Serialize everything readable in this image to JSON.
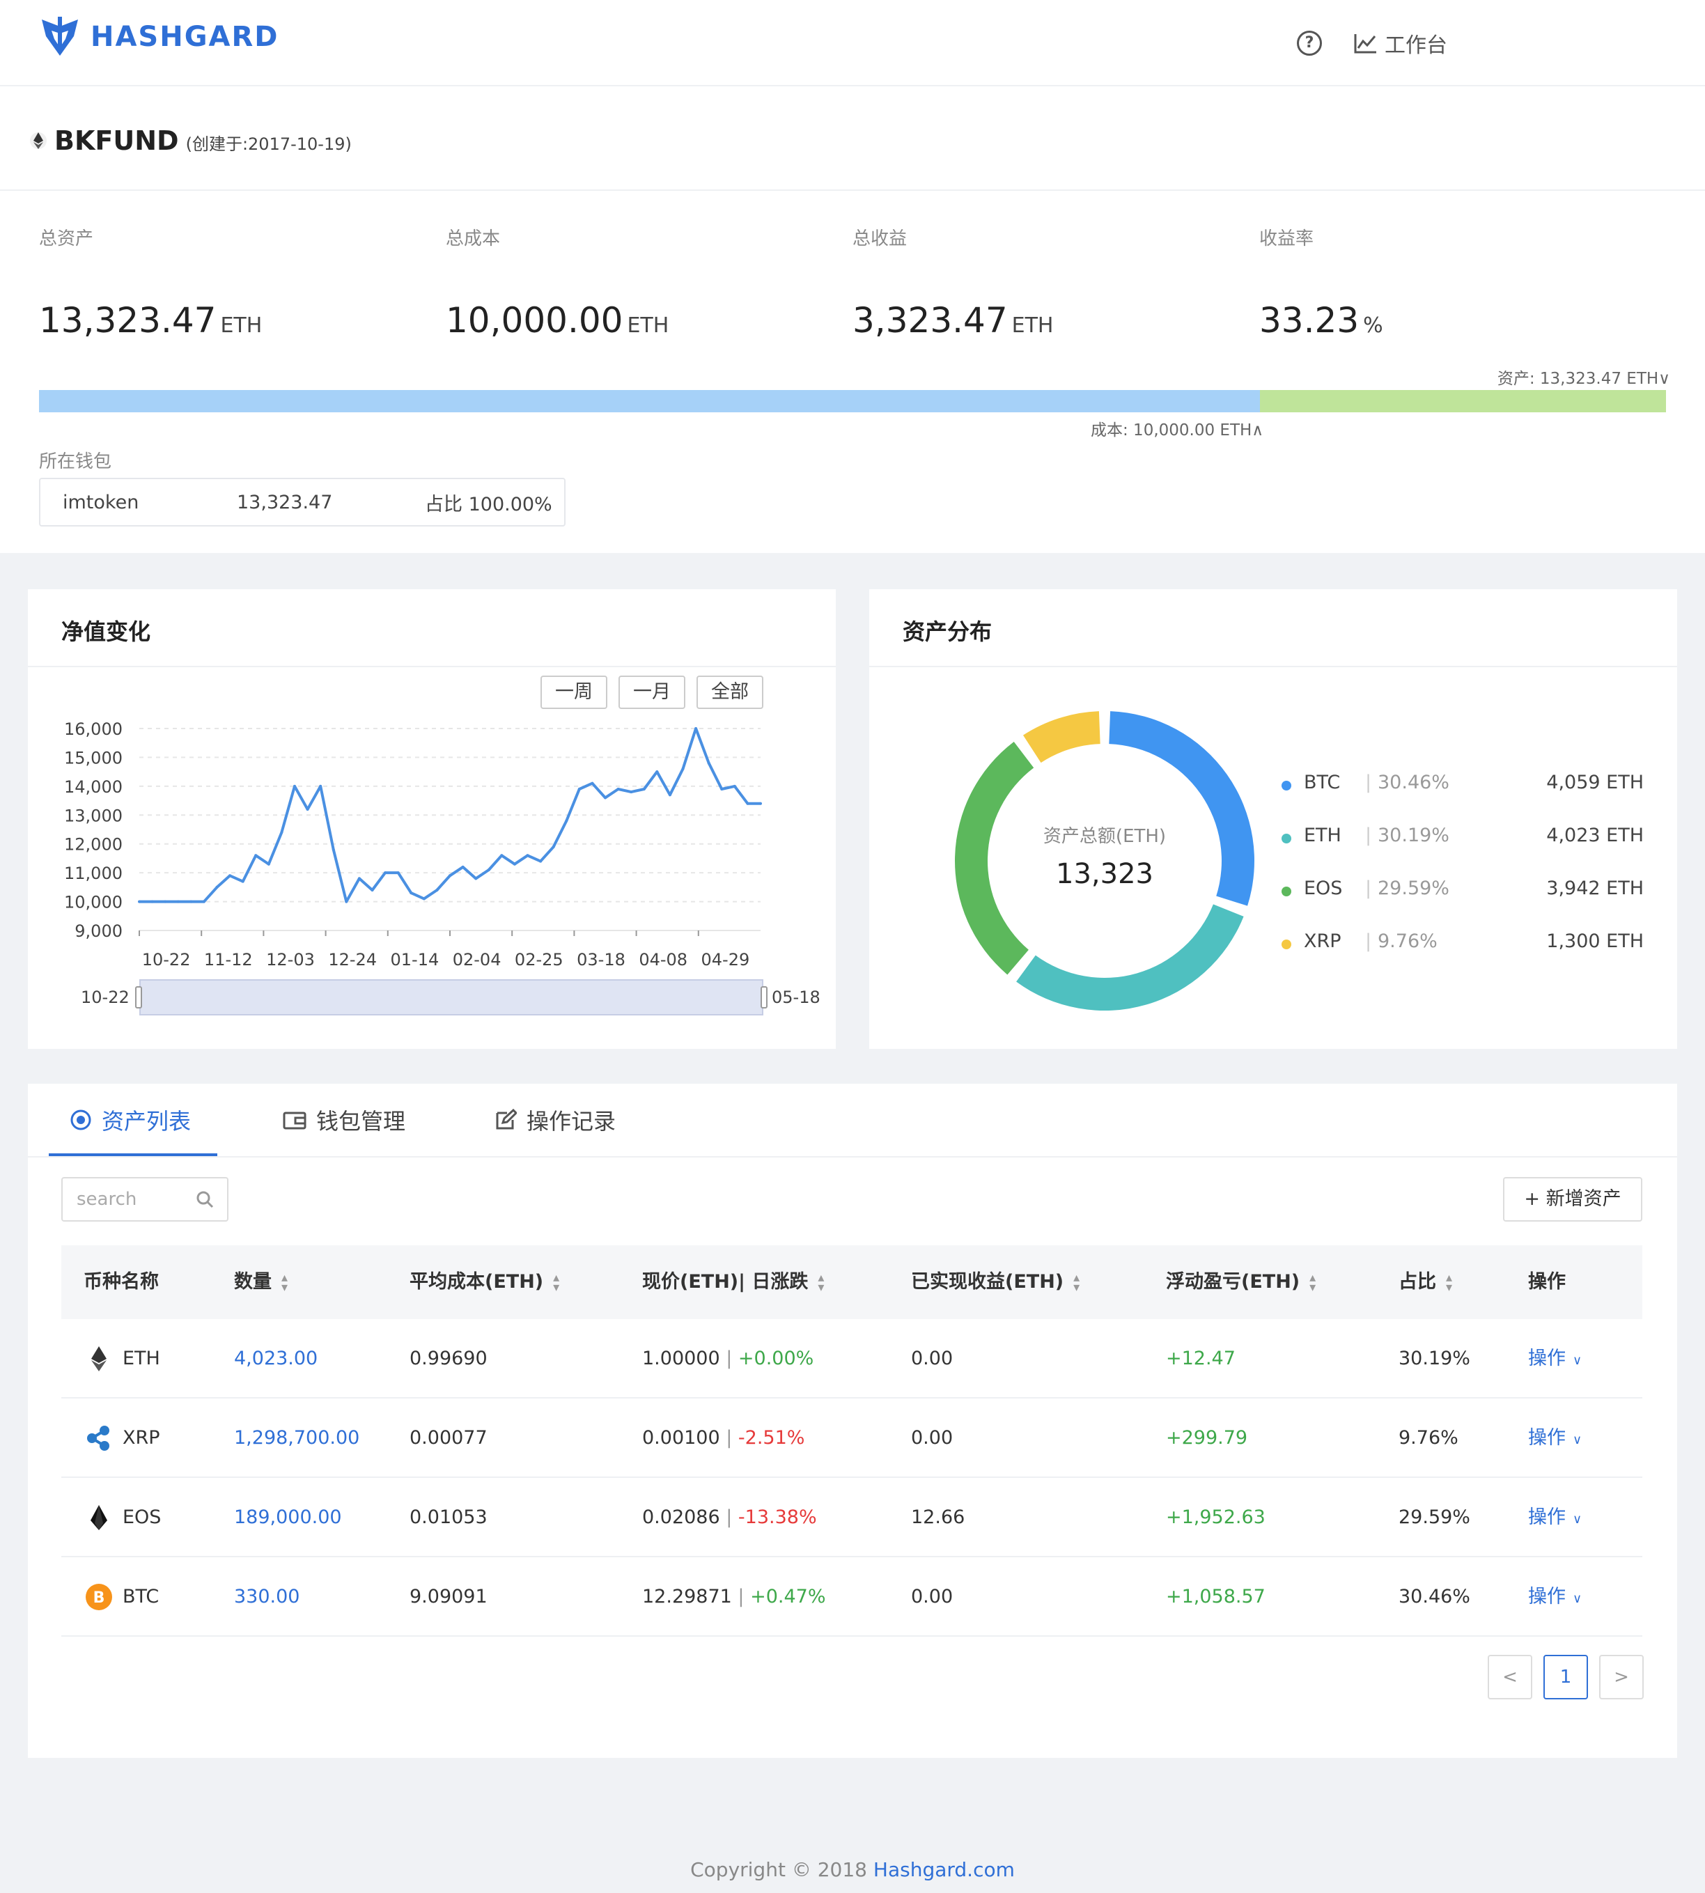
{
  "header": {
    "brand": "HASHGARD",
    "help_icon": "question-circle-icon",
    "workbench_label": "工作台",
    "workbench_icon": "line-chart-icon"
  },
  "fund": {
    "name": "BKFUND",
    "created": "(创建于:2017-10-19)",
    "stats": [
      {
        "label": "总资产",
        "value": "13,323.47",
        "unit": "ETH"
      },
      {
        "label": "总成本",
        "value": "10,000.00",
        "unit": "ETH"
      },
      {
        "label": "总收益",
        "value": "3,323.47",
        "unit": "ETH"
      },
      {
        "label": "收益率",
        "value": "33.23",
        "unit": "%"
      }
    ],
    "asset_bar_label": "资产: 13,323.47 ETH∨",
    "cost_bar_label": "成本: 10,000.00 ETH∧",
    "cost_fraction": 0.7506,
    "wallet_section_label": "所在钱包",
    "wallet": {
      "name": "imtoken",
      "amount": "13,323.47",
      "share": "占比 100.00%"
    }
  },
  "nav_chart": {
    "title": "净值变化",
    "range_buttons": [
      "一周",
      "一月",
      "全部"
    ],
    "zoom_start": "10-22",
    "zoom_end": "05-18"
  },
  "distribution": {
    "title": "资产分布",
    "center_label": "资产总额(ETH)",
    "center_value": "13,323",
    "items": [
      {
        "name": "BTC",
        "pct": "30.46%",
        "amount": "4,059 ETH",
        "color": "#4095f1"
      },
      {
        "name": "ETH",
        "pct": "30.19%",
        "amount": "4,023 ETH",
        "color": "#4fc0c0"
      },
      {
        "name": "EOS",
        "pct": "29.59%",
        "amount": "3,942 ETH",
        "color": "#5cb85c"
      },
      {
        "name": "XRP",
        "pct": "9.76%",
        "amount": "1,300 ETH",
        "color": "#f5c842"
      }
    ]
  },
  "tabs": [
    {
      "label": "资产列表",
      "icon": "coin-circle-icon"
    },
    {
      "label": "钱包管理",
      "icon": "wallet-icon"
    },
    {
      "label": "操作记录",
      "icon": "edit-icon"
    }
  ],
  "table": {
    "search_placeholder": "search",
    "add_button": "+ 新增资产",
    "headers": [
      "币种名称",
      "数量",
      "平均成本(ETH)",
      "现价(ETH)| 日涨跌",
      "已实现收益(ETH)",
      "浮动盈亏(ETH)",
      "占比",
      "操作"
    ],
    "rows": [
      {
        "coin": "ETH",
        "icon": "eth-icon",
        "qty": "4,023.00",
        "avg": "0.99690",
        "price": "1.00000",
        "change": "+0.00%",
        "realized": "0.00",
        "floating": "+12.47",
        "share": "30.19%",
        "action": "操作"
      },
      {
        "coin": "XRP",
        "icon": "xrp-icon",
        "qty": "1,298,700.00",
        "avg": "0.00077",
        "price": "0.00100",
        "change": "-2.51%",
        "realized": "0.00",
        "floating": "+299.79",
        "share": "9.76%",
        "action": "操作"
      },
      {
        "coin": "EOS",
        "icon": "eos-icon",
        "qty": "189,000.00",
        "avg": "0.01053",
        "price": "0.02086",
        "change": "-13.38%",
        "realized": "12.66",
        "floating": "+1,952.63",
        "share": "29.59%",
        "action": "操作"
      },
      {
        "coin": "BTC",
        "icon": "btc-icon",
        "qty": "330.00",
        "avg": "9.09091",
        "price": "12.29871",
        "change": "+0.47%",
        "realized": "0.00",
        "floating": "+1,058.57",
        "share": "30.46%",
        "action": "操作"
      }
    ],
    "pagination": {
      "prev": "<",
      "current": "1",
      "next": ">"
    }
  },
  "footer": {
    "prefix": "Copyright © 2018 ",
    "link": "Hashgard.com"
  },
  "chart_data": {
    "type": "line",
    "title": "",
    "xlabel": "",
    "ylabel": "",
    "ylim": [
      9000,
      16000
    ],
    "yticks": [
      "16,000",
      "15,000",
      "14,000",
      "13,000",
      "12,000",
      "11,000",
      "10,000",
      "9,000"
    ],
    "xticks": [
      "10-22",
      "11-12",
      "12-03",
      "12-24",
      "01-14",
      "02-04",
      "02-25",
      "03-18",
      "04-08",
      "04-29"
    ],
    "grid": true,
    "color": "#4a90e2",
    "x": [
      "10-22",
      "11-01",
      "11-12",
      "11-22",
      "12-03",
      "12-06",
      "12-09",
      "12-12",
      "12-15",
      "12-18",
      "12-21",
      "12-24",
      "12-27",
      "12-30",
      "01-02",
      "01-05",
      "01-08",
      "01-11",
      "01-14",
      "01-18",
      "01-22",
      "01-26",
      "01-30",
      "02-04",
      "02-08",
      "02-12",
      "02-16",
      "02-20",
      "02-25",
      "03-01",
      "03-05",
      "03-09",
      "03-13",
      "03-18",
      "03-22",
      "03-26",
      "03-30",
      "04-03",
      "04-08",
      "04-12",
      "04-16",
      "04-20",
      "04-24",
      "04-29",
      "05-03",
      "05-07",
      "05-11",
      "05-15",
      "05-18"
    ],
    "series": [
      {
        "values": [
          10000,
          10000,
          10000,
          10000,
          10000,
          10000,
          10500,
          10900,
          10700,
          11600,
          11300,
          12400,
          14000,
          13200,
          14000,
          11800,
          10000,
          10800,
          10400,
          11000,
          11000,
          10300,
          10100,
          10400,
          10900,
          11200,
          10800,
          11100,
          11600,
          11300,
          11600,
          11400,
          11900,
          12800,
          13900,
          14100,
          13600,
          13900,
          13800,
          13900,
          14500,
          13700,
          14600,
          16000,
          14800,
          13900,
          14000,
          13400,
          13400
        ]
      }
    ]
  }
}
